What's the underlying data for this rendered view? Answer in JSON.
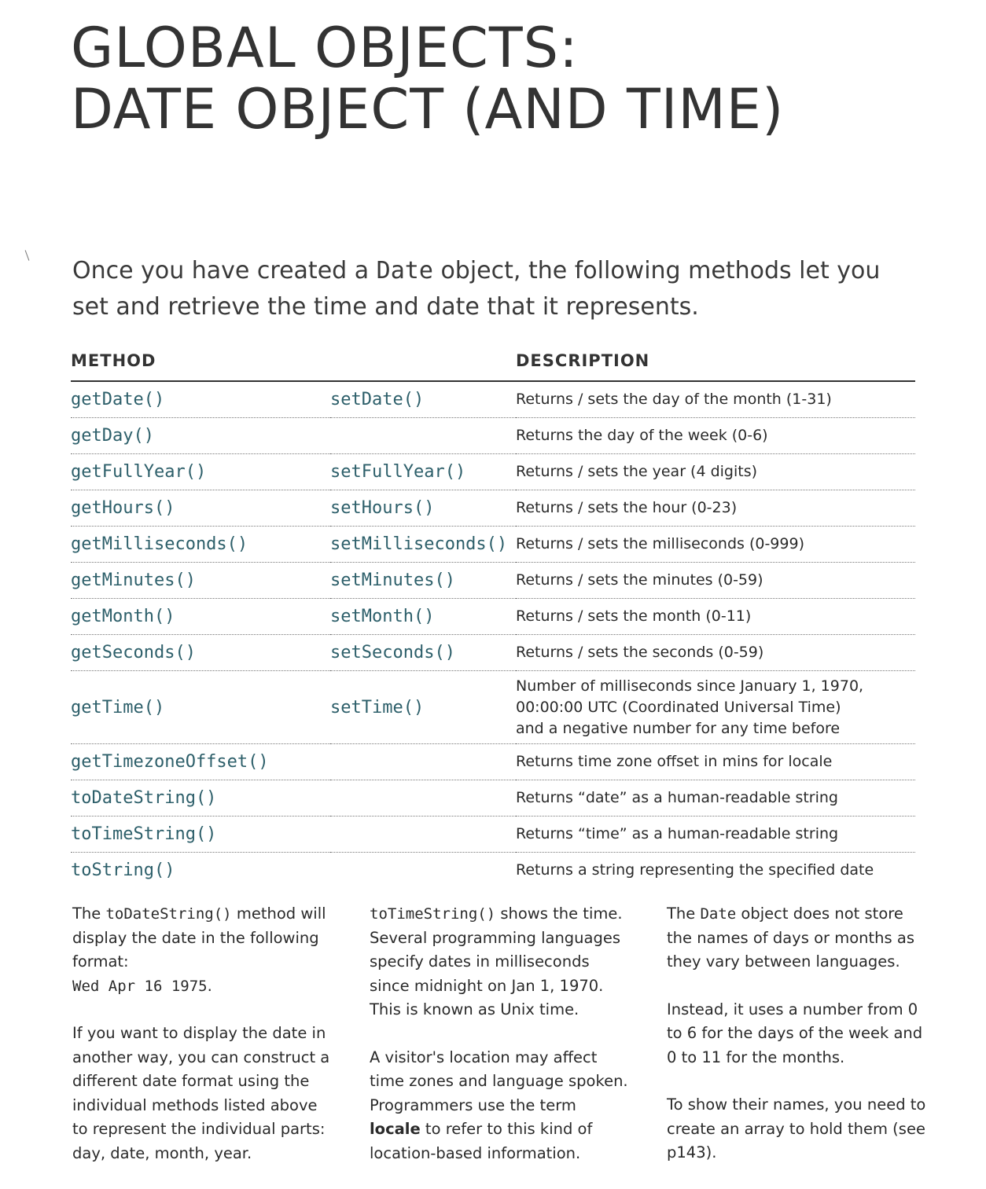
{
  "title": {
    "line1": "GLOBAL OBJECTS:",
    "line2": "DATE OBJECT (AND TIME)"
  },
  "intro": {
    "before": "Once you have created a ",
    "code": "Date",
    "after": " object, the following methods let you set and retrieve the time and date that it represents."
  },
  "table": {
    "headers": {
      "method": "METHOD",
      "description": "DESCRIPTION"
    },
    "rows": [
      {
        "get": "getDate()",
        "set": "setDate()",
        "desc": "Returns / sets the day of the month (1-31)"
      },
      {
        "get": "getDay()",
        "set": "",
        "desc": "Returns the day of the week (0-6)"
      },
      {
        "get": "getFullYear()",
        "set": "setFullYear()",
        "desc": "Returns / sets the year (4 digits)"
      },
      {
        "get": "getHours()",
        "set": "setHours()",
        "desc": "Returns / sets the hour (0-23)"
      },
      {
        "get": "getMilliseconds()",
        "set": "setMilliseconds()",
        "desc": "Returns / sets the milliseconds (0-999)"
      },
      {
        "get": "getMinutes()",
        "set": "setMinutes()",
        "desc": "Returns / sets the minutes (0-59)"
      },
      {
        "get": "getMonth()",
        "set": "setMonth()",
        "desc": "Returns / sets the month (0-11)"
      },
      {
        "get": "getSeconds()",
        "set": "setSeconds()",
        "desc": "Returns / sets the seconds (0-59)"
      },
      {
        "get": "getTime()",
        "set": "setTime()",
        "desc_lines": [
          "Number of milliseconds since January 1, 1970,",
          "00:00:00 UTC (Coordinated Universal Time)",
          "and a negative number for any time before"
        ]
      },
      {
        "get": "getTimezoneOffset()",
        "set": "",
        "desc": "Returns time zone offset in mins for locale"
      },
      {
        "get": "toDateString()",
        "set": "",
        "desc": "Returns “date” as a human-readable string"
      },
      {
        "get": "toTimeString()",
        "set": "",
        "desc": "Returns “time” as a human-readable string"
      },
      {
        "get": "toString()",
        "set": "",
        "desc": "Returns a string representing the specified date"
      }
    ]
  },
  "notes": {
    "col1": {
      "p1_before": "The ",
      "p1_code": "toDateString()",
      "p1_after": " method will display the date in the following format:",
      "p1_example": "Wed Apr 16 1975",
      "p1_end": ".",
      "p2": "If you want to display the date in another way, you can construct a different date format using the individual methods listed above to represent the individual parts: day, date, month, year."
    },
    "col2": {
      "p1_code": "toTimeString()",
      "p1_after": " shows the time. Several programming languages specify dates in milliseconds since midnight on Jan 1, 1970. This is known as Unix time.",
      "p2_before": "A visitor's location may affect time zones and language spoken. Programmers use the term ",
      "p2_bold": "locale",
      "p2_after": " to refer to this kind of location-based information."
    },
    "col3": {
      "p1_before": "The ",
      "p1_code": "Date",
      "p1_after": " object does not store the names of days or months as they vary between languages.",
      "p2": "Instead, it uses a number from 0 to 6 for the days of the week and 0 to 11 for the months.",
      "p3": "To show their names, you need to create an array to hold them (see p143)."
    }
  }
}
